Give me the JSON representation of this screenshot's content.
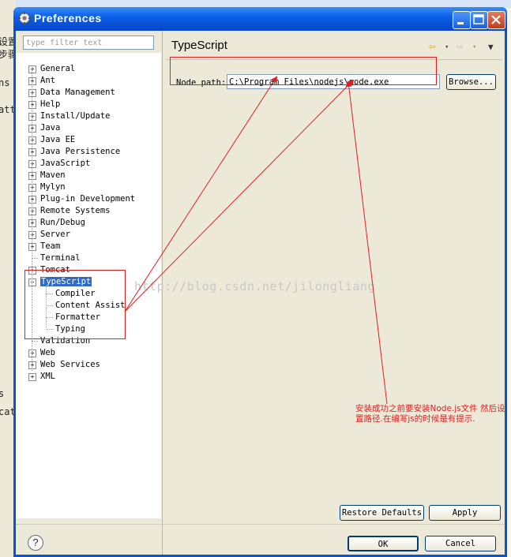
{
  "window": {
    "title": "Preferences"
  },
  "filter": {
    "placeholder": "type filter text"
  },
  "tree": {
    "items": [
      {
        "label": "General",
        "expander": "+"
      },
      {
        "label": "Ant",
        "expander": "+"
      },
      {
        "label": "Data Management",
        "expander": "+"
      },
      {
        "label": "Help",
        "expander": "+"
      },
      {
        "label": "Install/Update",
        "expander": "+"
      },
      {
        "label": "Java",
        "expander": "+"
      },
      {
        "label": "Java EE",
        "expander": "+"
      },
      {
        "label": "Java Persistence",
        "expander": "+"
      },
      {
        "label": "JavaScript",
        "expander": "+"
      },
      {
        "label": "Maven",
        "expander": "+"
      },
      {
        "label": "Mylyn",
        "expander": "+"
      },
      {
        "label": "Plug-in Development",
        "expander": "+"
      },
      {
        "label": "Remote Systems",
        "expander": "+"
      },
      {
        "label": "Run/Debug",
        "expander": "+"
      },
      {
        "label": "Server",
        "expander": "+"
      },
      {
        "label": "Team",
        "expander": "+"
      },
      {
        "label": "Terminal",
        "expander": ""
      },
      {
        "label": "Tomcat",
        "expander": "+"
      },
      {
        "label": "TypeScript",
        "expander": "-",
        "selected": true
      },
      {
        "label": "Compiler",
        "child": true
      },
      {
        "label": "Content Assist",
        "child": true
      },
      {
        "label": "Formatter",
        "child": true
      },
      {
        "label": "Typing",
        "child": true
      },
      {
        "label": "Validation",
        "expander": ""
      },
      {
        "label": "Web",
        "expander": "+"
      },
      {
        "label": "Web Services",
        "expander": "+"
      },
      {
        "label": "XML",
        "expander": "+"
      }
    ]
  },
  "page": {
    "title": "TypeScript",
    "node_path_label": "Node path:",
    "node_path_value": "C:\\Program Files\\nodejs\\node.exe",
    "browse_label": "Browse..."
  },
  "buttons": {
    "restore_defaults": "Restore Defaults",
    "apply": "Apply",
    "ok": "OK",
    "cancel": "Cancel"
  },
  "background": {
    "fragments": [
      "设置",
      "步骤",
      "ns",
      "att",
      "s",
      "cat"
    ]
  },
  "watermark": "http://blog.csdn.net/jilongliang",
  "annotation": "安装成功之前要安装Node.js文件 然后设置路径.在编写js的时候是有提示.",
  "colors": {
    "accent": "#316ac5",
    "annotation": "#e02020",
    "titlebar": "#0a5fe8"
  }
}
